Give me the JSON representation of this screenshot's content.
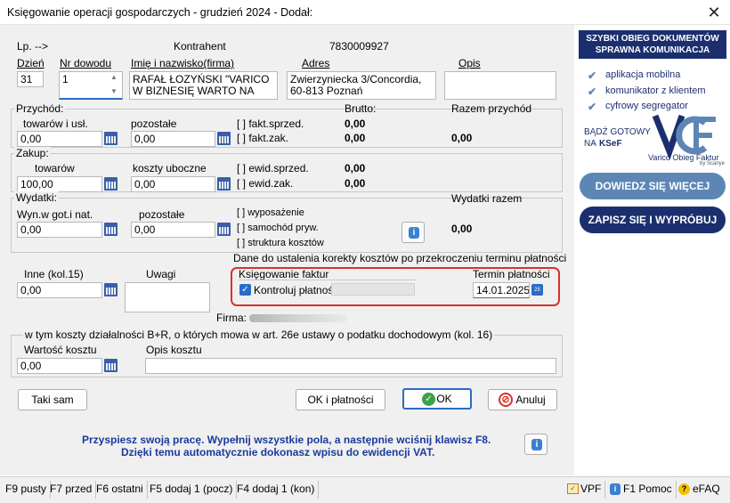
{
  "window": {
    "title": "Księgowanie operacji gospodarczych - grudzień 2024 - Dodał:"
  },
  "header": {
    "lp": "Lp. -->",
    "kontrahent_label": "Kontrahent",
    "nip": "7830009927",
    "dzien_label": "Dzień",
    "dzien_value": "31",
    "nr_dowodu_label": "Nr dowodu",
    "nr_dowodu_value": "1",
    "imie_label": "Imię i nazwisko(firma)",
    "imie_value_line1": "RAFAŁ ŁOZYŃSKI \"VARICO",
    "imie_value_line2": "W BIZNESIĘ WARTO NA",
    "adres_label": "Adres",
    "adres_line1": "Zwierzyniecka 3/Concordia,",
    "adres_line2": "60-813 Poznań",
    "opis_label": "Opis",
    "opis_value": ""
  },
  "przychod": {
    "group_label": "Przychód:",
    "towarow_label": "towarów i usł.",
    "towarow_value": "0,00",
    "pozostale_label": "pozostałe",
    "pozostale_value": "0,00",
    "brutto_label": "Brutto:",
    "razem_label": "Razem przychód",
    "fakt_sprzed": "[ ] fakt.sprzed.",
    "fakt_sprzed_val": "0,00",
    "fakt_zak": "[ ] fakt.zak.",
    "fakt_zak_val": "0,00",
    "razem_val": "0,00"
  },
  "zakup": {
    "group_label": "Zakup:",
    "towarow_label": "towarów",
    "towarow_value": "100,00",
    "koszty_label": "koszty uboczne",
    "koszty_value": "0,00",
    "ewid_sprzed": "[ ] ewid.sprzed.",
    "ewid_sprzed_val": "0,00",
    "ewid_zak": "[ ] ewid.zak.",
    "ewid_zak_val": "0,00"
  },
  "wydatki": {
    "group_label": "Wydatki:",
    "wyn_label": "Wyn.w got.i nat.",
    "wyn_value": "0,00",
    "pozostale_label": "pozostałe",
    "pozostale_value": "0,00",
    "razem_label": "Wydatki razem",
    "razem_val": "0,00",
    "wyposazenie": "[ ] wyposażenie",
    "samochod": "[ ] samochód pryw.",
    "struktura": "[ ] struktura kosztów"
  },
  "inne": {
    "inne_label": "Inne (kol.15)",
    "inne_value": "0,00",
    "uwagi_label": "Uwagi"
  },
  "korekta": {
    "heading": "Dane do ustalenia korekty kosztów po przekroczeniu terminu płatności",
    "ksiegowanie_label": "Księgowanie faktur",
    "kontroluj_label": "Kontroluj płatności",
    "kontroluj_checked": true,
    "termin_label": "Termin płatności",
    "termin_value": "14.01.2025"
  },
  "firma_label": "Firma:",
  "br": {
    "heading": "w tym koszty działalności B+R, o których mowa w art. 26e ustawy o podatku dochodowym (kol. 16)",
    "wartosc_label": "Wartość kosztu",
    "wartosc_value": "0,00",
    "opis_label": "Opis kosztu"
  },
  "buttons": {
    "taki_sam": "Taki sam",
    "ok_platnosci": "OK i płatności",
    "ok": "OK",
    "anuluj": "Anuluj"
  },
  "hint": {
    "line1": "Przyspiesz swoją pracę. Wypełnij wszystkie pola, a następnie wciśnij klawisz F8.",
    "line2": "Dzięki temu automatycznie dokonasz wpisu do ewidencji VAT."
  },
  "status_bar": {
    "f9": "F9 pusty",
    "f7": "F7 przed",
    "f6": "F6 ostatni",
    "f5": "F5 dodaj 1 (pocz)",
    "f4": "F4 dodaj 1 (kon)",
    "vpf": "VPF",
    "f1": "F1 Pomoc",
    "efaq": "eFAQ"
  },
  "ad": {
    "banner_line1": "SZYBKI OBIEG DOKUMENTÓW",
    "banner_line2": "SPRAWNA KOMUNIKACJA",
    "items": [
      "aplikacja mobilna",
      "komunikator z klientem",
      "cyfrowy segregator"
    ],
    "ready_line1": "BĄDŹ GOTOWY",
    "ready_line2": "NA",
    "ready_ksef": "KSeF",
    "logo_text": "Varico Obieg Faktur",
    "logo_sub": "by Scanye",
    "btn_more": "DOWIEDZ SIĘ WIĘCEJ",
    "btn_try": "ZAPISZ SIĘ I WYPRÓBUJ",
    "colors": {
      "navy": "#1b2f6e",
      "steel": "#5d86b5",
      "accent": "#3b6ea8"
    }
  },
  "highlight_color": "#d9302c"
}
